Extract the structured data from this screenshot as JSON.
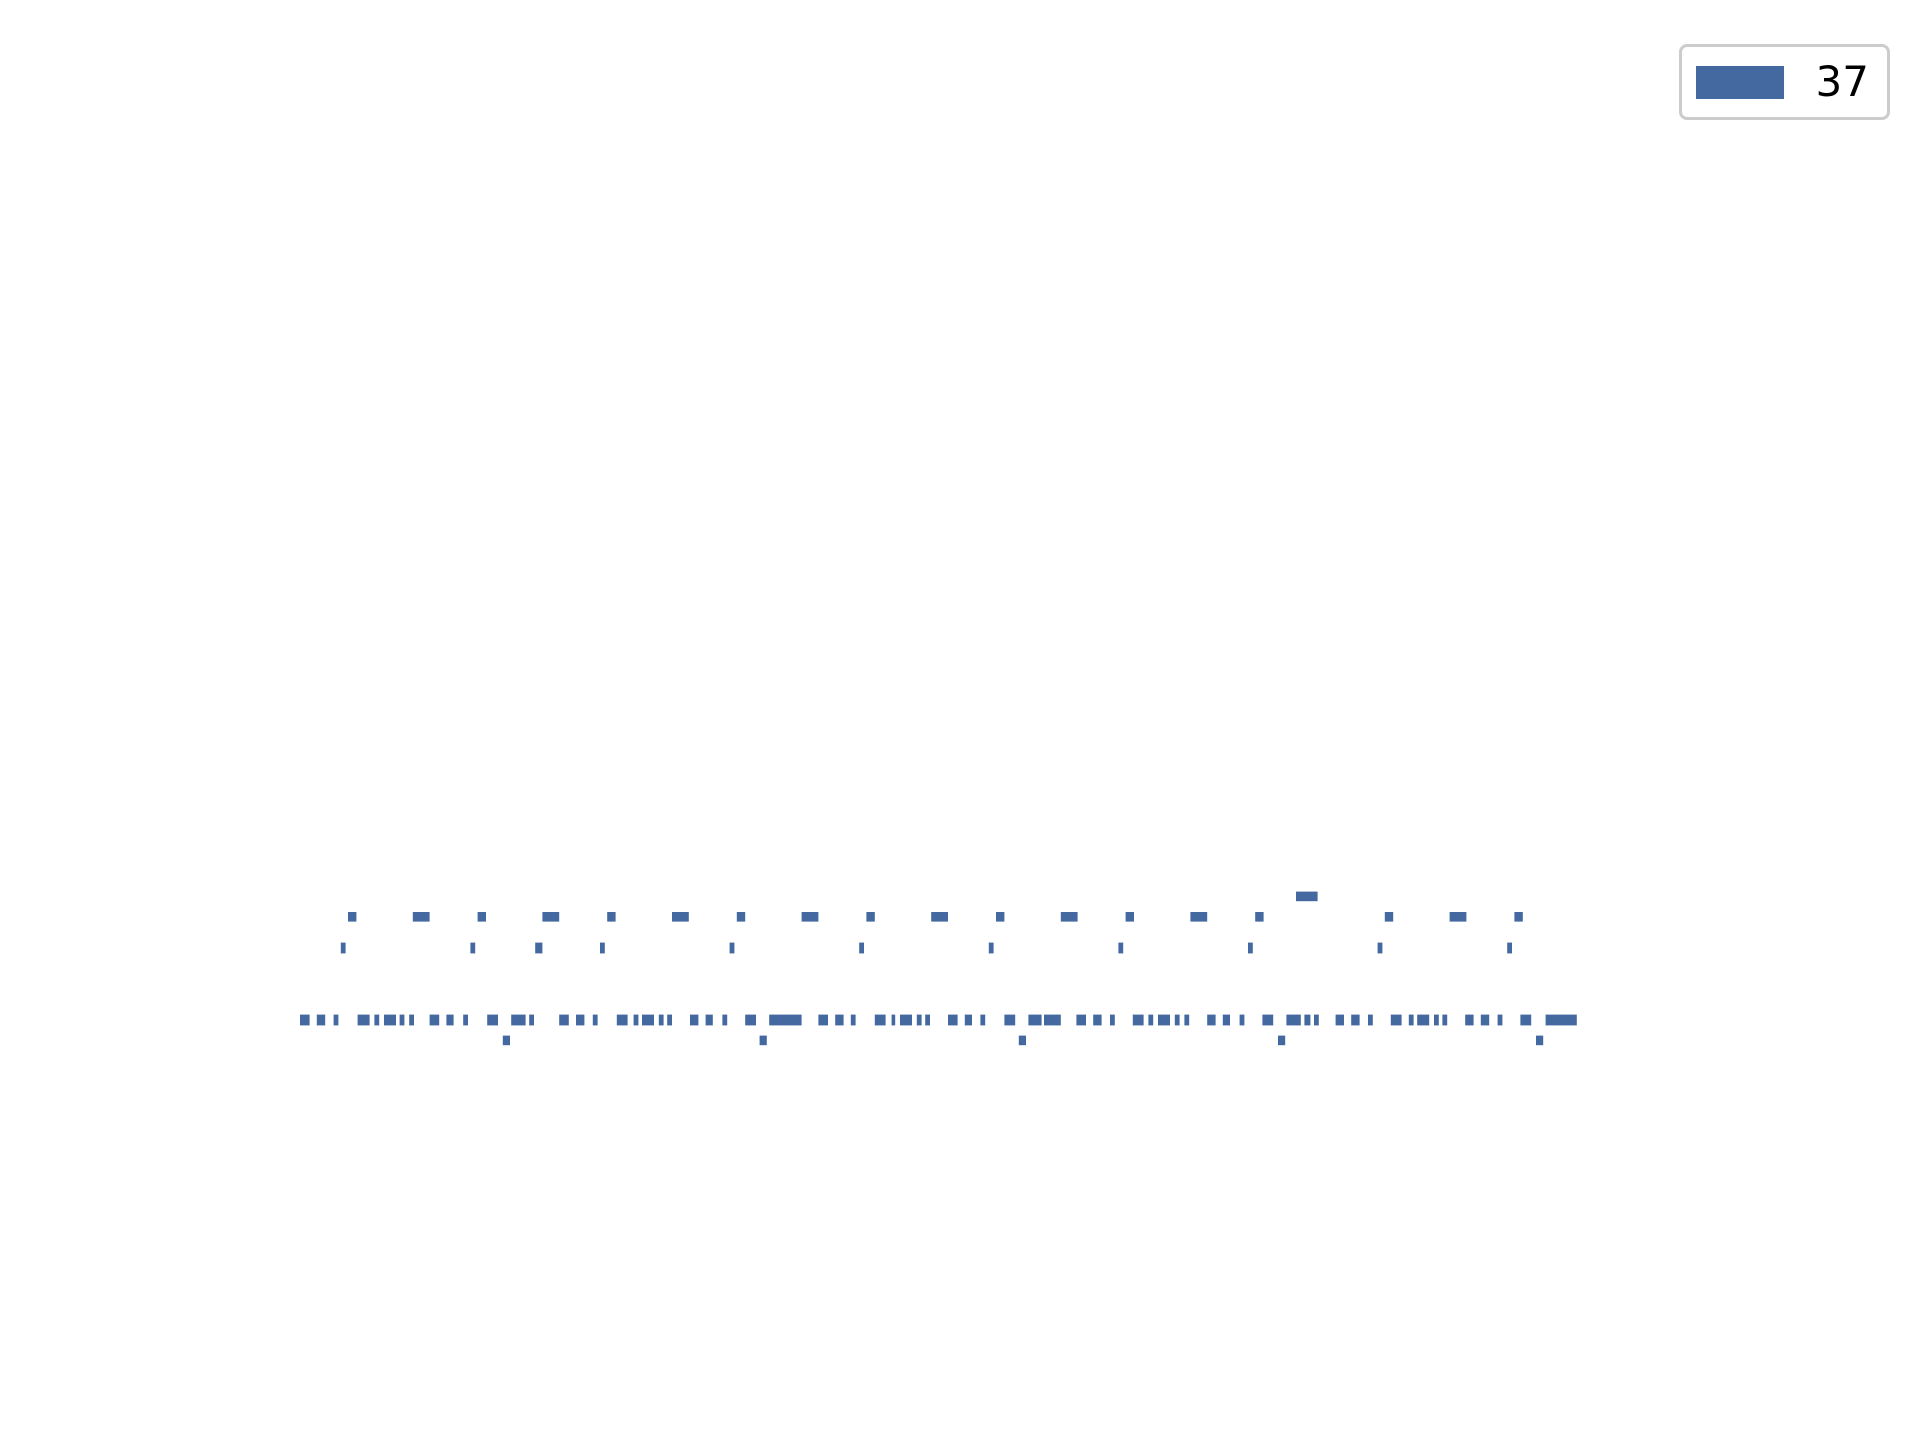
{
  "chart_data": {
    "type": "bar",
    "orientation": "horizontal",
    "color": "#4469a0",
    "legend": {
      "position": "top-right",
      "entries": [
        "37"
      ]
    },
    "axes_visible": false,
    "grid": false,
    "tiers": [
      {
        "row": 1,
        "segments": [
          [
            1080,
            1098
          ]
        ]
      },
      {
        "row": 2,
        "segments": [
          [
            290,
            297
          ],
          [
            344,
            358
          ],
          [
            398,
            405
          ],
          [
            452,
            466
          ],
          [
            506,
            513
          ],
          [
            560,
            574
          ],
          [
            614,
            621
          ],
          [
            668,
            682
          ],
          [
            722,
            729
          ],
          [
            776,
            790
          ],
          [
            830,
            837
          ],
          [
            884,
            898
          ],
          [
            938,
            945
          ],
          [
            992,
            1006
          ],
          [
            1046,
            1053
          ],
          [
            1154,
            1161
          ],
          [
            1208,
            1222
          ],
          [
            1262,
            1269
          ]
        ]
      },
      {
        "row": 3,
        "segments": [
          [
            284,
            288
          ],
          [
            392,
            396
          ],
          [
            446,
            452
          ],
          [
            500,
            504
          ],
          [
            608,
            612
          ],
          [
            716,
            720
          ],
          [
            824,
            828
          ],
          [
            932,
            936
          ],
          [
            1040,
            1044
          ],
          [
            1148,
            1152
          ],
          [
            1256,
            1260
          ]
        ]
      },
      {
        "row": 4,
        "segments": [
          [
            250,
            258
          ],
          [
            264,
            271
          ],
          [
            278,
            282
          ],
          [
            298,
            308
          ],
          [
            312,
            316
          ],
          [
            320,
            330
          ],
          [
            333,
            337
          ],
          [
            341,
            345
          ],
          [
            358,
            366
          ],
          [
            372,
            378
          ],
          [
            386,
            390
          ],
          [
            406,
            415
          ],
          [
            426,
            438
          ],
          [
            441,
            445
          ],
          [
            466,
            474
          ],
          [
            480,
            487
          ],
          [
            494,
            498
          ],
          [
            514,
            523
          ],
          [
            528,
            532
          ],
          [
            535,
            545
          ],
          [
            549,
            553
          ],
          [
            556,
            560
          ],
          [
            575,
            582
          ],
          [
            588,
            594
          ],
          [
            602,
            606
          ],
          [
            621,
            630
          ],
          [
            641,
            668
          ],
          [
            682,
            690
          ],
          [
            696,
            703
          ],
          [
            709,
            713
          ],
          [
            729,
            738
          ],
          [
            743,
            746
          ],
          [
            750,
            760
          ],
          [
            764,
            768
          ],
          [
            771,
            775
          ],
          [
            790,
            798
          ],
          [
            804,
            810
          ],
          [
            817,
            821
          ],
          [
            837,
            846
          ],
          [
            857,
            868
          ],
          [
            870,
            884
          ],
          [
            897,
            905
          ],
          [
            911,
            918
          ],
          [
            925,
            929
          ],
          [
            944,
            953
          ],
          [
            957,
            961
          ],
          [
            965,
            975
          ],
          [
            979,
            983
          ],
          [
            987,
            991
          ],
          [
            1006,
            1013
          ],
          [
            1019,
            1025
          ],
          [
            1033,
            1037
          ],
          [
            1052,
            1061
          ],
          [
            1072,
            1084
          ],
          [
            1087,
            1092
          ],
          [
            1095,
            1099
          ],
          [
            1113,
            1120
          ],
          [
            1126,
            1133
          ],
          [
            1140,
            1144
          ],
          [
            1159,
            1168
          ],
          [
            1174,
            1178
          ],
          [
            1181,
            1191
          ],
          [
            1195,
            1199
          ],
          [
            1202,
            1206
          ],
          [
            1221,
            1228
          ],
          [
            1234,
            1241
          ],
          [
            1248,
            1252
          ],
          [
            1267,
            1276
          ],
          [
            1288,
            1314
          ]
        ]
      },
      {
        "row": 5,
        "segments": [
          [
            419,
            425
          ],
          [
            633,
            639
          ],
          [
            849,
            855
          ],
          [
            1065,
            1071
          ],
          [
            1280,
            1286
          ]
        ]
      }
    ]
  }
}
